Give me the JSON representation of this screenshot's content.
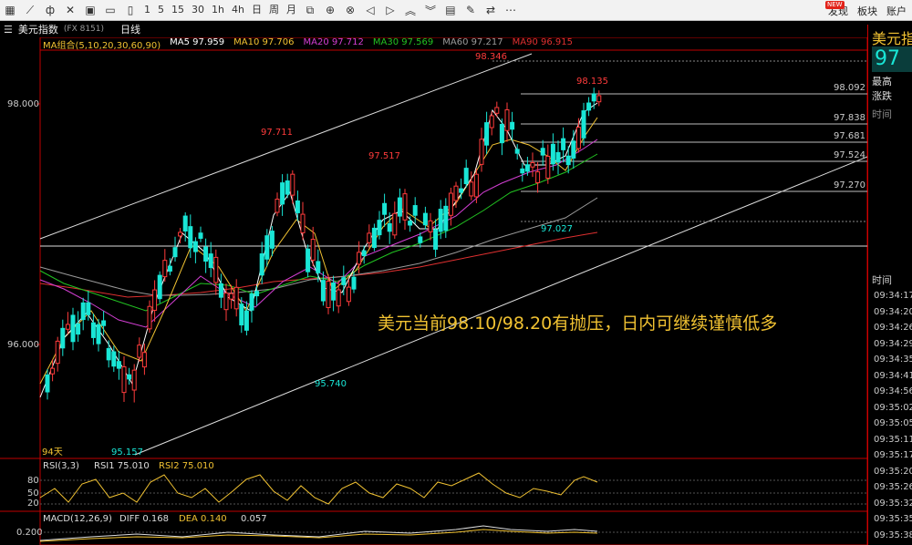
{
  "toolbar": {
    "icons": [
      "grid-icon",
      "line-icon",
      "candle-icon",
      "crossline-icon",
      "bar-icon",
      "save-icon",
      "doc-icon"
    ],
    "periods": [
      "1",
      "5",
      "15",
      "30",
      "1h",
      "4h",
      "日",
      "周",
      "月"
    ],
    "right_items": [
      "发现",
      "板块",
      "账户"
    ],
    "new_badge": "NEW"
  },
  "header": {
    "symbol": "美元指数",
    "code": "(FX 8151)",
    "period": "日线"
  },
  "ma": {
    "group": "MA组合(5,10,20,30,60,90)",
    "items": [
      {
        "label": "MA5 97.959",
        "color": "#ffffff"
      },
      {
        "label": "MA10 97.706",
        "color": "#f1c232"
      },
      {
        "label": "MA20 97.712",
        "color": "#d43fd4"
      },
      {
        "label": "MA30 97.569",
        "color": "#22c322"
      },
      {
        "label": "MA60 97.217",
        "color": "#9a9a9a"
      },
      {
        "label": "MA90 96.915",
        "color": "#e03030"
      }
    ]
  },
  "price_axis": [
    "98.000",
    "96.000"
  ],
  "price_labels": {
    "p98346": "98.346",
    "p98135": "98.135",
    "p97711": "97.711",
    "p97517": "97.517",
    "p97027": "97.027",
    "p95740": "95.740",
    "p95157": "95.157"
  },
  "levels": [
    "98.092",
    "97.838",
    "97.681",
    "97.524",
    "97.270"
  ],
  "days": "94天",
  "rsi": {
    "title": "RSI(3,3)",
    "rsi1": "RSI1 75.010",
    "rsi2": "RSI2 75.010",
    "ticks": [
      "80",
      "50",
      "20"
    ]
  },
  "macd": {
    "title": "MACD(12,26,9)",
    "diff": "DIFF 0.168",
    "dea": "DEA 0.140",
    "val": "0.057",
    "tick": "0.200"
  },
  "annotation": "美元当前98.10/98.20有抛压，日内可继续谨慎低多",
  "quote": {
    "name": "美元指",
    "price": "97",
    "high_label": "最高",
    "change_label": "涨跌",
    "time_label": "时间",
    "time_label2": "时间",
    "times": [
      "09:34:17",
      "09:34:20",
      "09:34:26",
      "09:34:29",
      "09:34:35",
      "09:34:41",
      "09:34:56",
      "09:35:02",
      "09:35:05",
      "09:35:11",
      "09:35:17",
      "09:35:20",
      "09:35:26",
      "09:35:32",
      "09:35:35",
      "09:35:38"
    ]
  },
  "colors": {
    "up": "#ff3b3b",
    "down": "#19e6d6",
    "accent": "#f1c232",
    "border": "#c00000"
  }
}
